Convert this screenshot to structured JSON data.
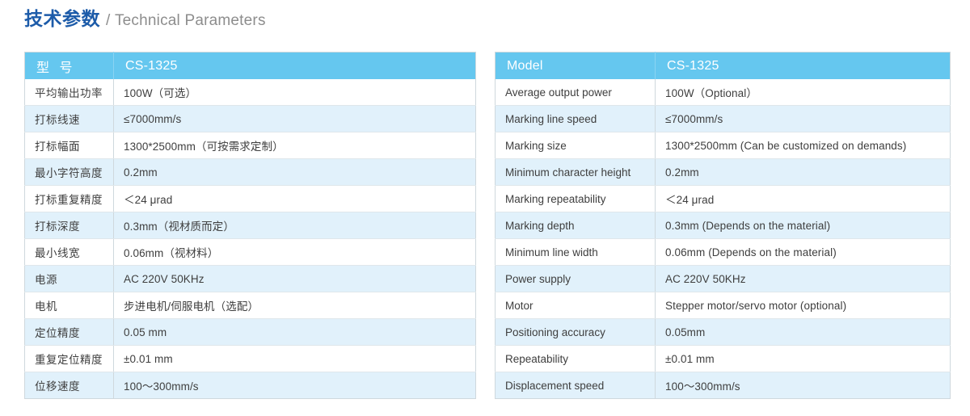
{
  "title": {
    "cn": "技术参数",
    "en": "/ Technical Parameters"
  },
  "colors": {
    "title_cn": "#1c5ba9",
    "title_en": "#8d8d8d",
    "header_bg": "#65c7ef",
    "header_text": "#ffffff",
    "row_stripe_bg": "#e1f1fb",
    "row_plain_bg": "#ffffff",
    "cell_text": "#3e3e3e",
    "border": "#cfd8dd"
  },
  "table_cn": {
    "header": {
      "label": "型 号",
      "value": "CS-1325"
    },
    "rows": [
      {
        "label": "平均输出功率",
        "value": "100W（可选）"
      },
      {
        "label": "打标线速",
        "value": "≤7000mm/s"
      },
      {
        "label": "打标幅面",
        "value": "1300*2500mm（可按需求定制）"
      },
      {
        "label": "最小字符高度",
        "value": "0.2mm"
      },
      {
        "label": "打标重复精度",
        "value": "＜24 μrad"
      },
      {
        "label": "打标深度",
        "value": "0.3mm（视材质而定）"
      },
      {
        "label": "最小线宽",
        "value": "0.06mm（视材料）"
      },
      {
        "label": "电源",
        "value": "AC 220V 50KHz"
      },
      {
        "label": "电机",
        "value": "步进电机/伺服电机（选配）"
      },
      {
        "label": "定位精度",
        "value": "0.05 mm"
      },
      {
        "label": "重复定位精度",
        "value": "±0.01 mm"
      },
      {
        "label": "位移速度",
        "value": "100～300mm/s"
      }
    ]
  },
  "table_en": {
    "header": {
      "label": "Model",
      "value": "CS-1325"
    },
    "rows": [
      {
        "label": "Average output power",
        "value": "100W（Optional）"
      },
      {
        "label": "Marking line speed",
        "value": "≤7000mm/s"
      },
      {
        "label": "Marking size",
        "value": "1300*2500mm (Can be customized on demands)"
      },
      {
        "label": "Minimum character height",
        "value": "0.2mm"
      },
      {
        "label": "Marking repeatability",
        "value": "＜24 μrad"
      },
      {
        "label": "Marking depth",
        "value": "0.3mm (Depends on the material)"
      },
      {
        "label": "Minimum line width",
        "value": "0.06mm (Depends on the material)"
      },
      {
        "label": "Power supply",
        "value": "AC 220V 50KHz"
      },
      {
        "label": "Motor",
        "value": "Stepper motor/servo motor (optional)"
      },
      {
        "label": "Positioning accuracy",
        "value": "0.05mm"
      },
      {
        "label": "Repeatability",
        "value": "±0.01 mm"
      },
      {
        "label": "Displacement speed",
        "value": "100～300mm/s"
      }
    ]
  }
}
